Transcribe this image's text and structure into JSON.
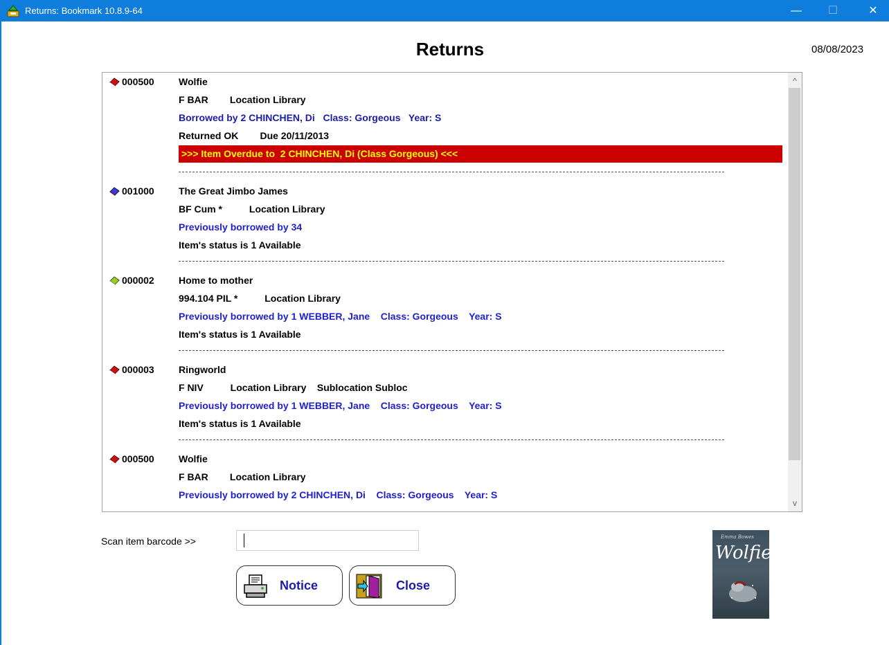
{
  "window": {
    "title": "Returns: Bookmark 10.8.9-64",
    "minimize": "—",
    "maximize": "☐",
    "close": "✕"
  },
  "header": {
    "title": "Returns",
    "date": "08/08/2023"
  },
  "colors": {
    "titlebar": "#0f7ddb",
    "overdue_bg": "#cc0000",
    "overdue_text": "#ffff00",
    "blue_text": "#2020cc"
  },
  "entries": [
    {
      "icon": "red-book-icon",
      "barcode": "000500",
      "title": "Wolfie",
      "call": "F BAR        Location Library",
      "borrow": "Borrowed by 2 CHINCHEN, Di   Class: Gorgeous   Year: S",
      "status": "Returned OK        Due 20/11/2013",
      "alert": ">>> Item Overdue to  2 CHINCHEN, Di (Class Gorgeous) <<<"
    },
    {
      "icon": "blue-book-icon",
      "barcode": "001000",
      "title": "The Great Jimbo James",
      "call": "BF Cum *          Location Library",
      "borrow": "Previously borrowed by 34",
      "status": "Item's status is 1 Available"
    },
    {
      "icon": "green-book-icon",
      "barcode": "000002",
      "title": "Home to mother",
      "call": "994.104 PIL *          Location Library",
      "borrow": "Previously borrowed by 1 WEBBER, Jane    Class: Gorgeous    Year: S",
      "status": "Item's status is 1 Available"
    },
    {
      "icon": "red-book-icon",
      "barcode": "000003",
      "title": "Ringworld",
      "call": "F NIV          Location Library    Sublocation Subloc",
      "borrow": "Previously borrowed by 1 WEBBER, Jane    Class: Gorgeous    Year: S",
      "status": "Item's status is 1 Available"
    },
    {
      "icon": "red-book-icon",
      "barcode": "000500",
      "title": "Wolfie",
      "call": "F BAR        Location Library",
      "borrow": "Previously borrowed by 2 CHINCHEN, Di    Class: Gorgeous    Year: S"
    }
  ],
  "scan": {
    "label": "Scan item barcode >>",
    "value": ""
  },
  "buttons": {
    "notice": "Notice",
    "close": "Close"
  },
  "cover": {
    "author": "Emma Bowes",
    "title": "Wolfie"
  }
}
